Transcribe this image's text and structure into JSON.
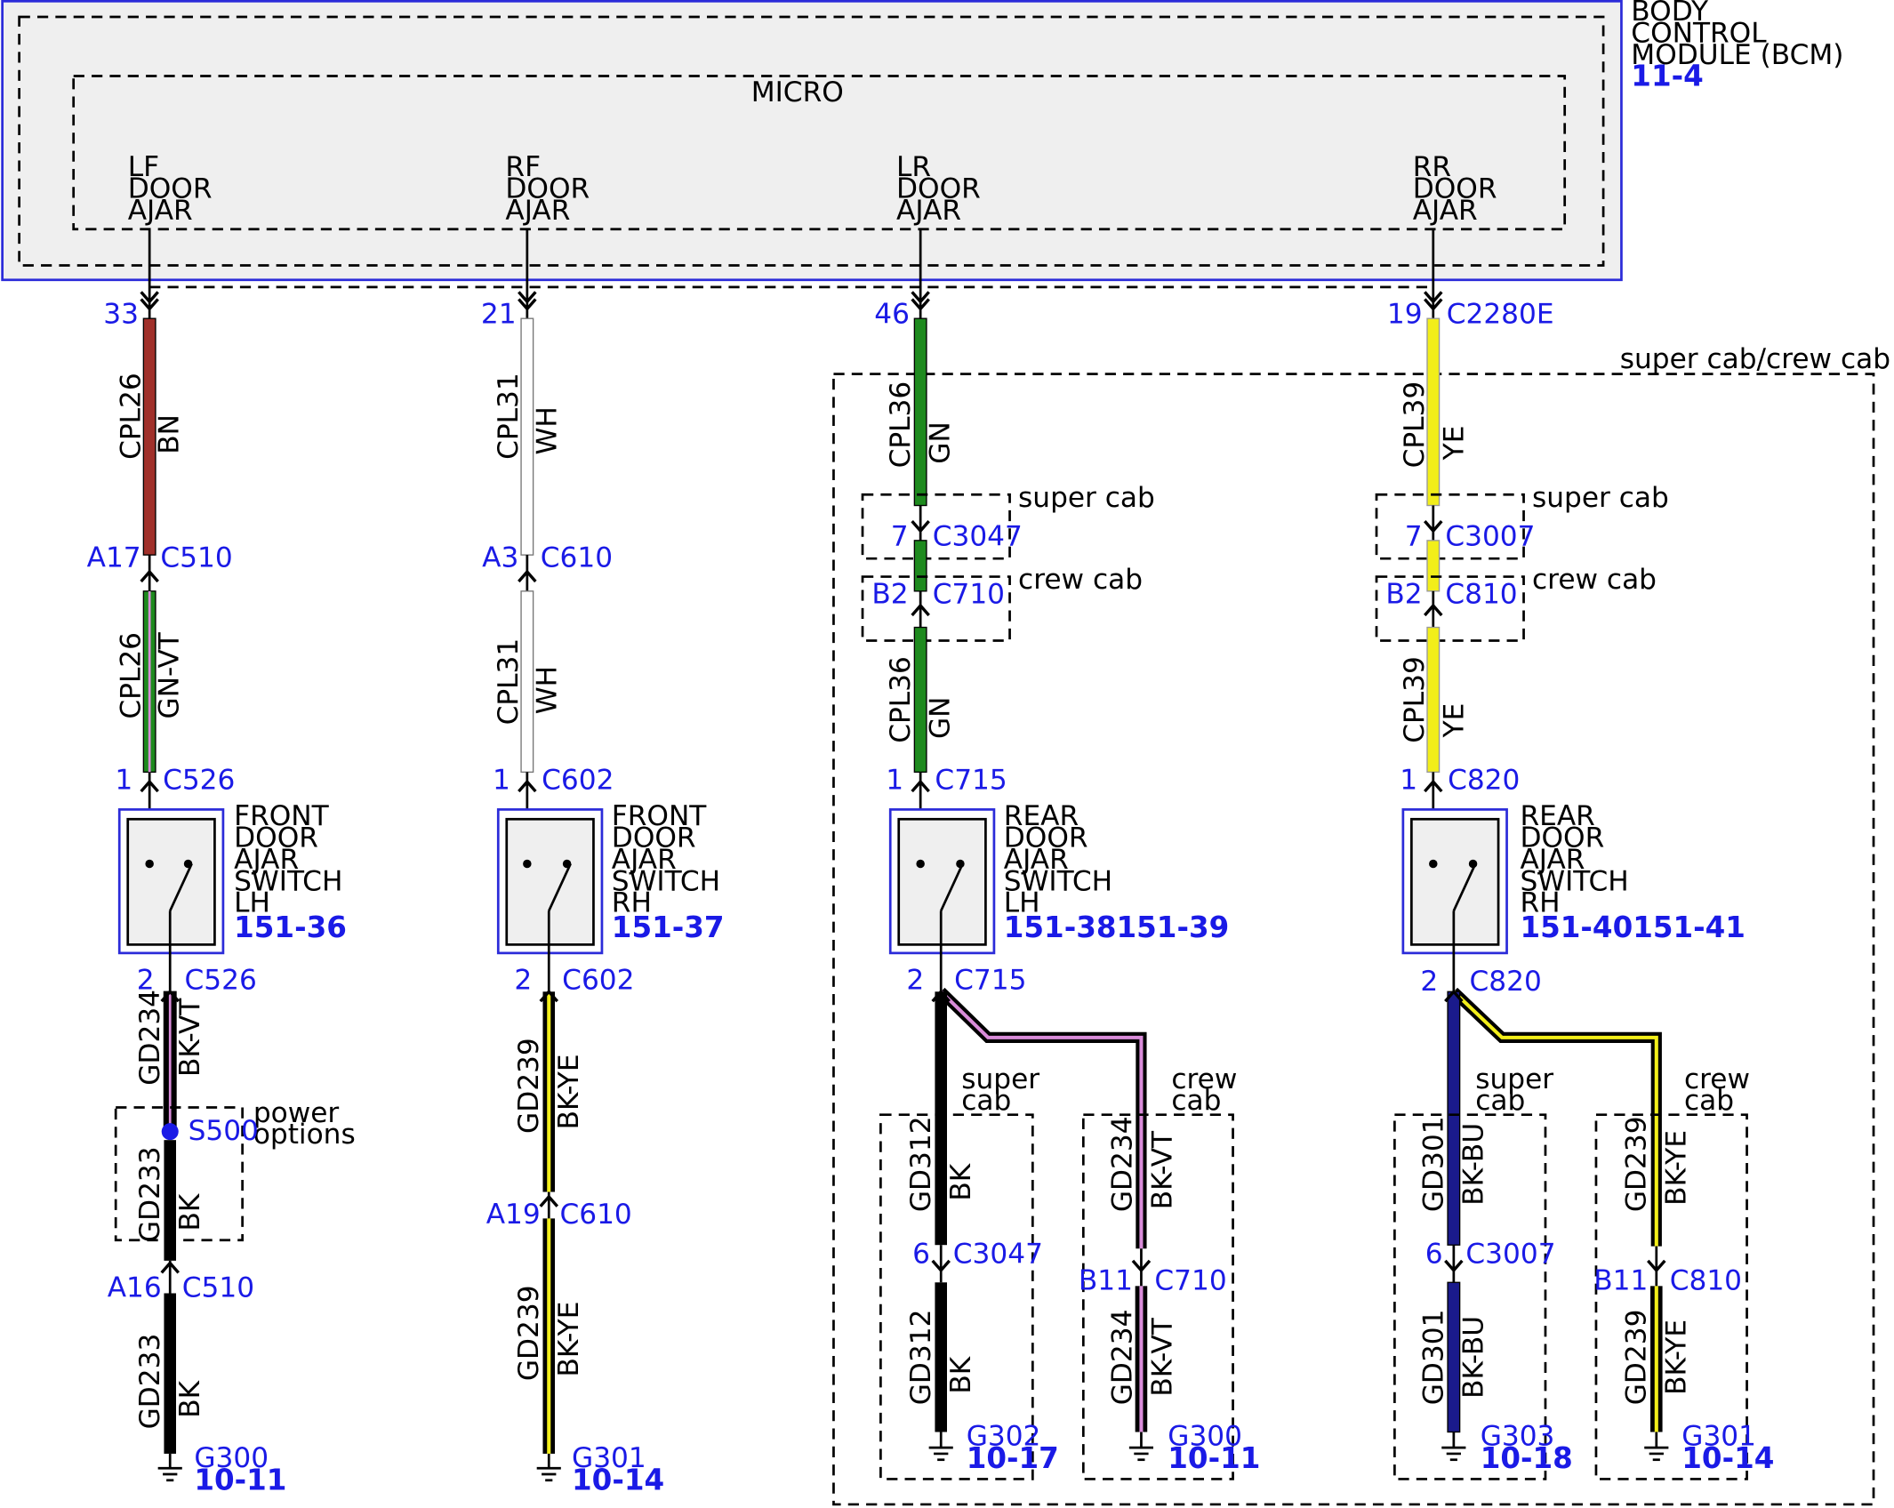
{
  "module": {
    "title_lines": [
      "BODY",
      "CONTROL",
      "MODULE (BCM)"
    ],
    "ref": "11-4",
    "inner_label": "MICRO",
    "outputs": [
      [
        "LF",
        "DOOR",
        "AJAR"
      ],
      [
        "RF",
        "DOOR",
        "AJAR"
      ],
      [
        "LR",
        "DOOR",
        "AJAR"
      ],
      [
        "RR",
        "DOOR",
        "AJAR"
      ]
    ]
  },
  "option_labels": {
    "super_crew": "super cab/crew cab",
    "super_cab": "super cab",
    "crew_cab": "crew cab",
    "super_cab_split": [
      "super",
      "cab"
    ],
    "crew_cab_split": [
      "crew",
      "cab"
    ],
    "power_options": [
      "power",
      "options"
    ]
  },
  "colors": {
    "BN": "#a0302a",
    "GN": "#1e8a1e",
    "WH": "#ffffff",
    "YE": "#f2ee1a",
    "BK": "#000000",
    "VT": "#d98cd9",
    "BU": "#1a1a8c",
    "module_border": "#2b2bd9",
    "module_fill": "#efefef",
    "splice": "#1a1ae6"
  },
  "circuits": {
    "lf": {
      "bcm_pin": "33",
      "wire1": {
        "circuit": "CPL26",
        "color": "BN"
      },
      "c1": {
        "pin": "A17",
        "name": "C510"
      },
      "wire2": {
        "circuit": "CPL26",
        "color": "GN-VT"
      },
      "sw_in": {
        "pin": "1",
        "name": "C526"
      },
      "switch": {
        "lines": [
          "FRONT",
          "DOOR",
          "AJAR",
          "SWITCH",
          "LH"
        ],
        "ref": "151-36"
      },
      "sw_out": {
        "pin": "2",
        "name": "C526"
      },
      "wire3": {
        "circuit": "GD234",
        "color": "BK-VT"
      },
      "splice": "S500",
      "wire4": {
        "circuit": "GD233",
        "color": "BK"
      },
      "c2": {
        "pin": "A16",
        "name": "C510"
      },
      "wire5": {
        "circuit": "GD233",
        "color": "BK"
      },
      "ground": {
        "name": "G300",
        "ref": "10-11"
      }
    },
    "rf": {
      "bcm_pin": "21",
      "wire1": {
        "circuit": "CPL31",
        "color": "WH"
      },
      "c1": {
        "pin": "A3",
        "name": "C610"
      },
      "wire2": {
        "circuit": "CPL31",
        "color": "WH"
      },
      "sw_in": {
        "pin": "1",
        "name": "C602"
      },
      "switch": {
        "lines": [
          "FRONT",
          "DOOR",
          "AJAR",
          "SWITCH",
          "RH"
        ],
        "ref": "151-37"
      },
      "sw_out": {
        "pin": "2",
        "name": "C602"
      },
      "wire3": {
        "circuit": "GD239",
        "color": "BK-YE"
      },
      "c2": {
        "pin": "A19",
        "name": "C610"
      },
      "wire4": {
        "circuit": "GD239",
        "color": "BK-YE"
      },
      "ground": {
        "name": "G301",
        "ref": "10-14"
      }
    },
    "lr": {
      "bcm_pin": "46",
      "wire1": {
        "circuit": "CPL36",
        "color": "GN"
      },
      "c_super": {
        "pin": "7",
        "name": "C3047"
      },
      "c_crew": {
        "pin": "B2",
        "name": "C710"
      },
      "wire2": {
        "circuit": "CPL36",
        "color": "GN"
      },
      "sw_in": {
        "pin": "1",
        "name": "C715"
      },
      "switch": {
        "lines": [
          "REAR",
          "DOOR",
          "AJAR",
          "SWITCH",
          "LH"
        ],
        "ref": "151-38151-39"
      },
      "sw_out": {
        "pin": "2",
        "name": "C715"
      },
      "branch_super": {
        "wire1": {
          "circuit": "GD312",
          "color": "BK"
        },
        "conn": {
          "pin": "6",
          "name": "C3047"
        },
        "wire2": {
          "circuit": "GD312",
          "color": "BK"
        },
        "ground": {
          "name": "G302",
          "ref": "10-17"
        }
      },
      "branch_crew": {
        "wire1": {
          "circuit": "GD234",
          "color": "BK-VT"
        },
        "conn": {
          "pin": "B11",
          "name": "C710"
        },
        "wire2": {
          "circuit": "GD234",
          "color": "BK-VT"
        },
        "ground": {
          "name": "G300",
          "ref": "10-11"
        }
      }
    },
    "rr": {
      "bcm_pin": "19",
      "bcm_conn": "C2280E",
      "wire1": {
        "circuit": "CPL39",
        "color": "YE"
      },
      "c_super": {
        "pin": "7",
        "name": "C3007"
      },
      "c_crew": {
        "pin": "B2",
        "name": "C810"
      },
      "wire2": {
        "circuit": "CPL39",
        "color": "YE"
      },
      "sw_in": {
        "pin": "1",
        "name": "C820"
      },
      "switch": {
        "lines": [
          "REAR",
          "DOOR",
          "AJAR",
          "SWITCH",
          "RH"
        ],
        "ref": "151-40151-41"
      },
      "sw_out": {
        "pin": "2",
        "name": "C820"
      },
      "branch_super": {
        "wire1": {
          "circuit": "GD301",
          "color": "BK-BU"
        },
        "conn": {
          "pin": "6",
          "name": "C3007"
        },
        "wire2": {
          "circuit": "GD301",
          "color": "BK-BU"
        },
        "ground": {
          "name": "G303",
          "ref": "10-18"
        }
      },
      "branch_crew": {
        "wire1": {
          "circuit": "GD239",
          "color": "BK-YE"
        },
        "conn": {
          "pin": "B11",
          "name": "C810"
        },
        "wire2": {
          "circuit": "GD239",
          "color": "BK-YE"
        },
        "ground": {
          "name": "G301",
          "ref": "10-14"
        }
      }
    }
  }
}
